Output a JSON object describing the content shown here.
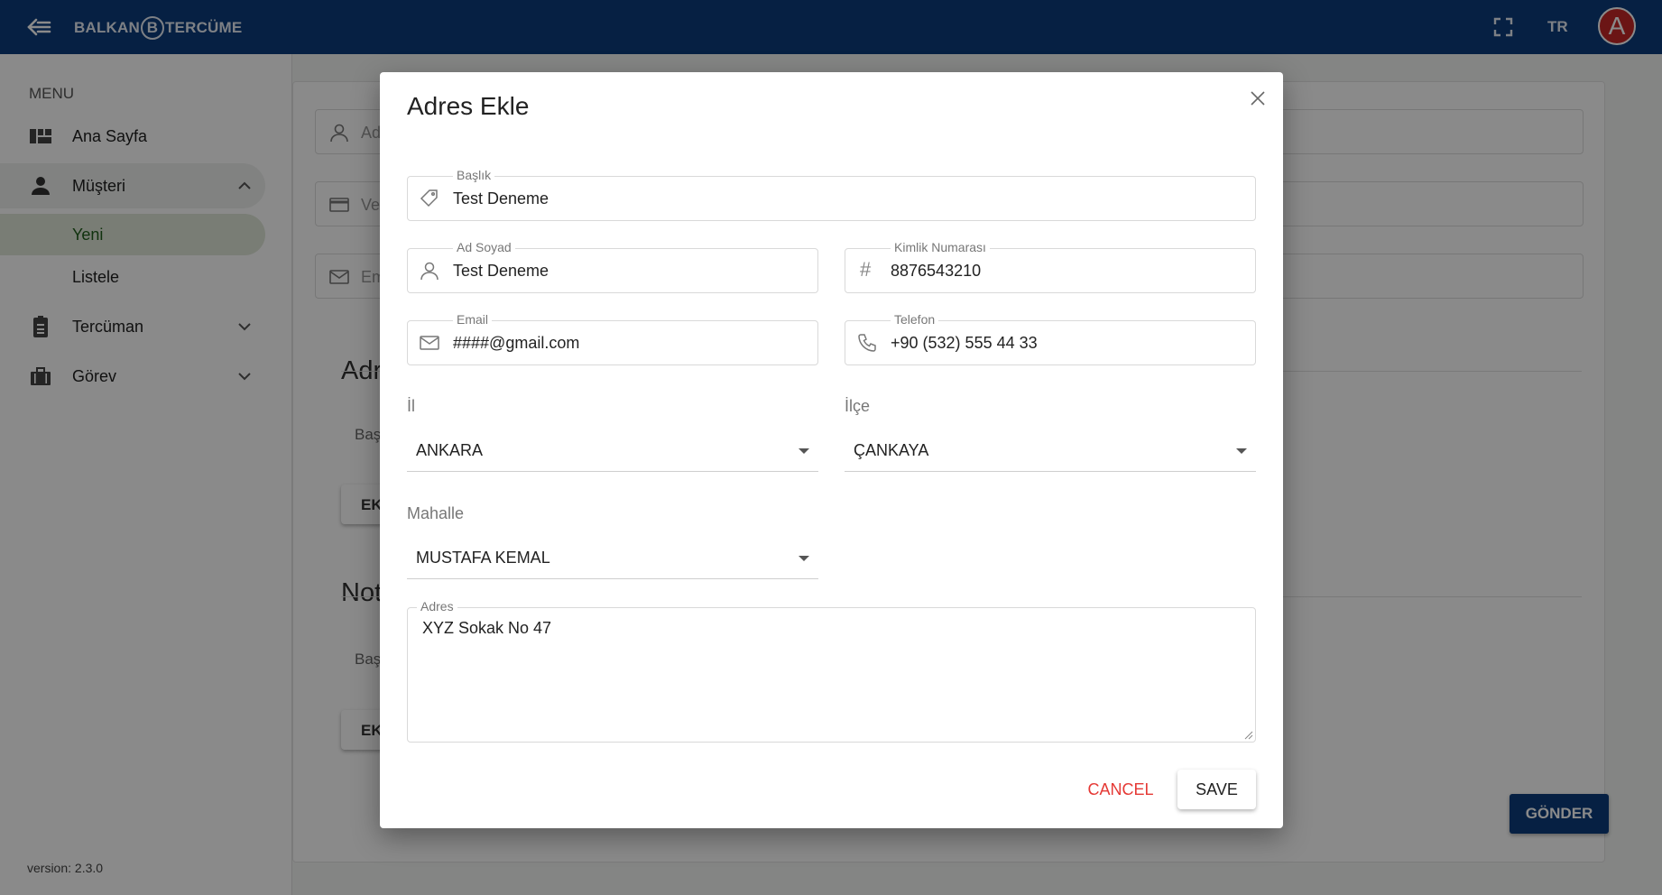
{
  "topbar": {
    "brand_left": "BALKAN",
    "brand_mark": "B",
    "brand_right": "TERCÜME",
    "language": "TR",
    "avatar_initial": "A",
    "color_bar": "#0c3c7c",
    "color_avatar": "#c62828"
  },
  "sidebar": {
    "menu_title": "MENU",
    "items": [
      {
        "label": "Ana Sayfa",
        "icon": "dashboard-icon"
      },
      {
        "label": "Müşteri",
        "icon": "person-icon",
        "expanded": true,
        "children": [
          {
            "label": "Yeni",
            "active": true
          },
          {
            "label": "Listele"
          }
        ]
      },
      {
        "label": "Tercüman",
        "icon": "badge-icon"
      },
      {
        "label": "Görev",
        "icon": "briefcase-icon"
      }
    ],
    "version": "version: 2.3.0"
  },
  "background": {
    "fields": [
      {
        "placeholder": "Ad",
        "icon": "person-icon"
      },
      {
        "placeholder": "Ver",
        "icon": "card-icon"
      },
      {
        "placeholder": "Em",
        "icon": "mail-icon"
      }
    ],
    "section_address": "Adr",
    "section_address_sub": "Baş",
    "add_button_1": "EK",
    "section_notes": "Not",
    "section_notes_sub": "Baş",
    "add_button_2": "EK",
    "submit_label": "GÖNDER"
  },
  "modal": {
    "title": "Adres Ekle",
    "fields": {
      "baslik": {
        "label": "Başlık",
        "value": "Test Deneme",
        "icon": "tag-icon"
      },
      "ad_soyad": {
        "label": "Ad Soyad",
        "value": "Test Deneme",
        "icon": "person-icon"
      },
      "kimlik": {
        "label": "Kimlik Numarası",
        "value": "8876543210",
        "icon": "hash-icon",
        "glyph": "#"
      },
      "email": {
        "label": "Email",
        "value": "####@gmail.com",
        "icon": "mail-icon"
      },
      "telefon": {
        "label": "Telefon",
        "value": "+90 (532) 555 44 33",
        "icon": "phone-icon"
      },
      "il": {
        "label": "İl",
        "value": "ANKARA"
      },
      "ilce": {
        "label": "İlçe",
        "value": "ÇANKAYA"
      },
      "mahalle": {
        "label": "Mahalle",
        "value": "MUSTAFA KEMAL"
      },
      "adres": {
        "label": "Adres",
        "value": "XYZ Sokak No 47"
      }
    },
    "cancel_label": "CANCEL",
    "save_label": "SAVE",
    "color_cancel": "#e53935"
  }
}
